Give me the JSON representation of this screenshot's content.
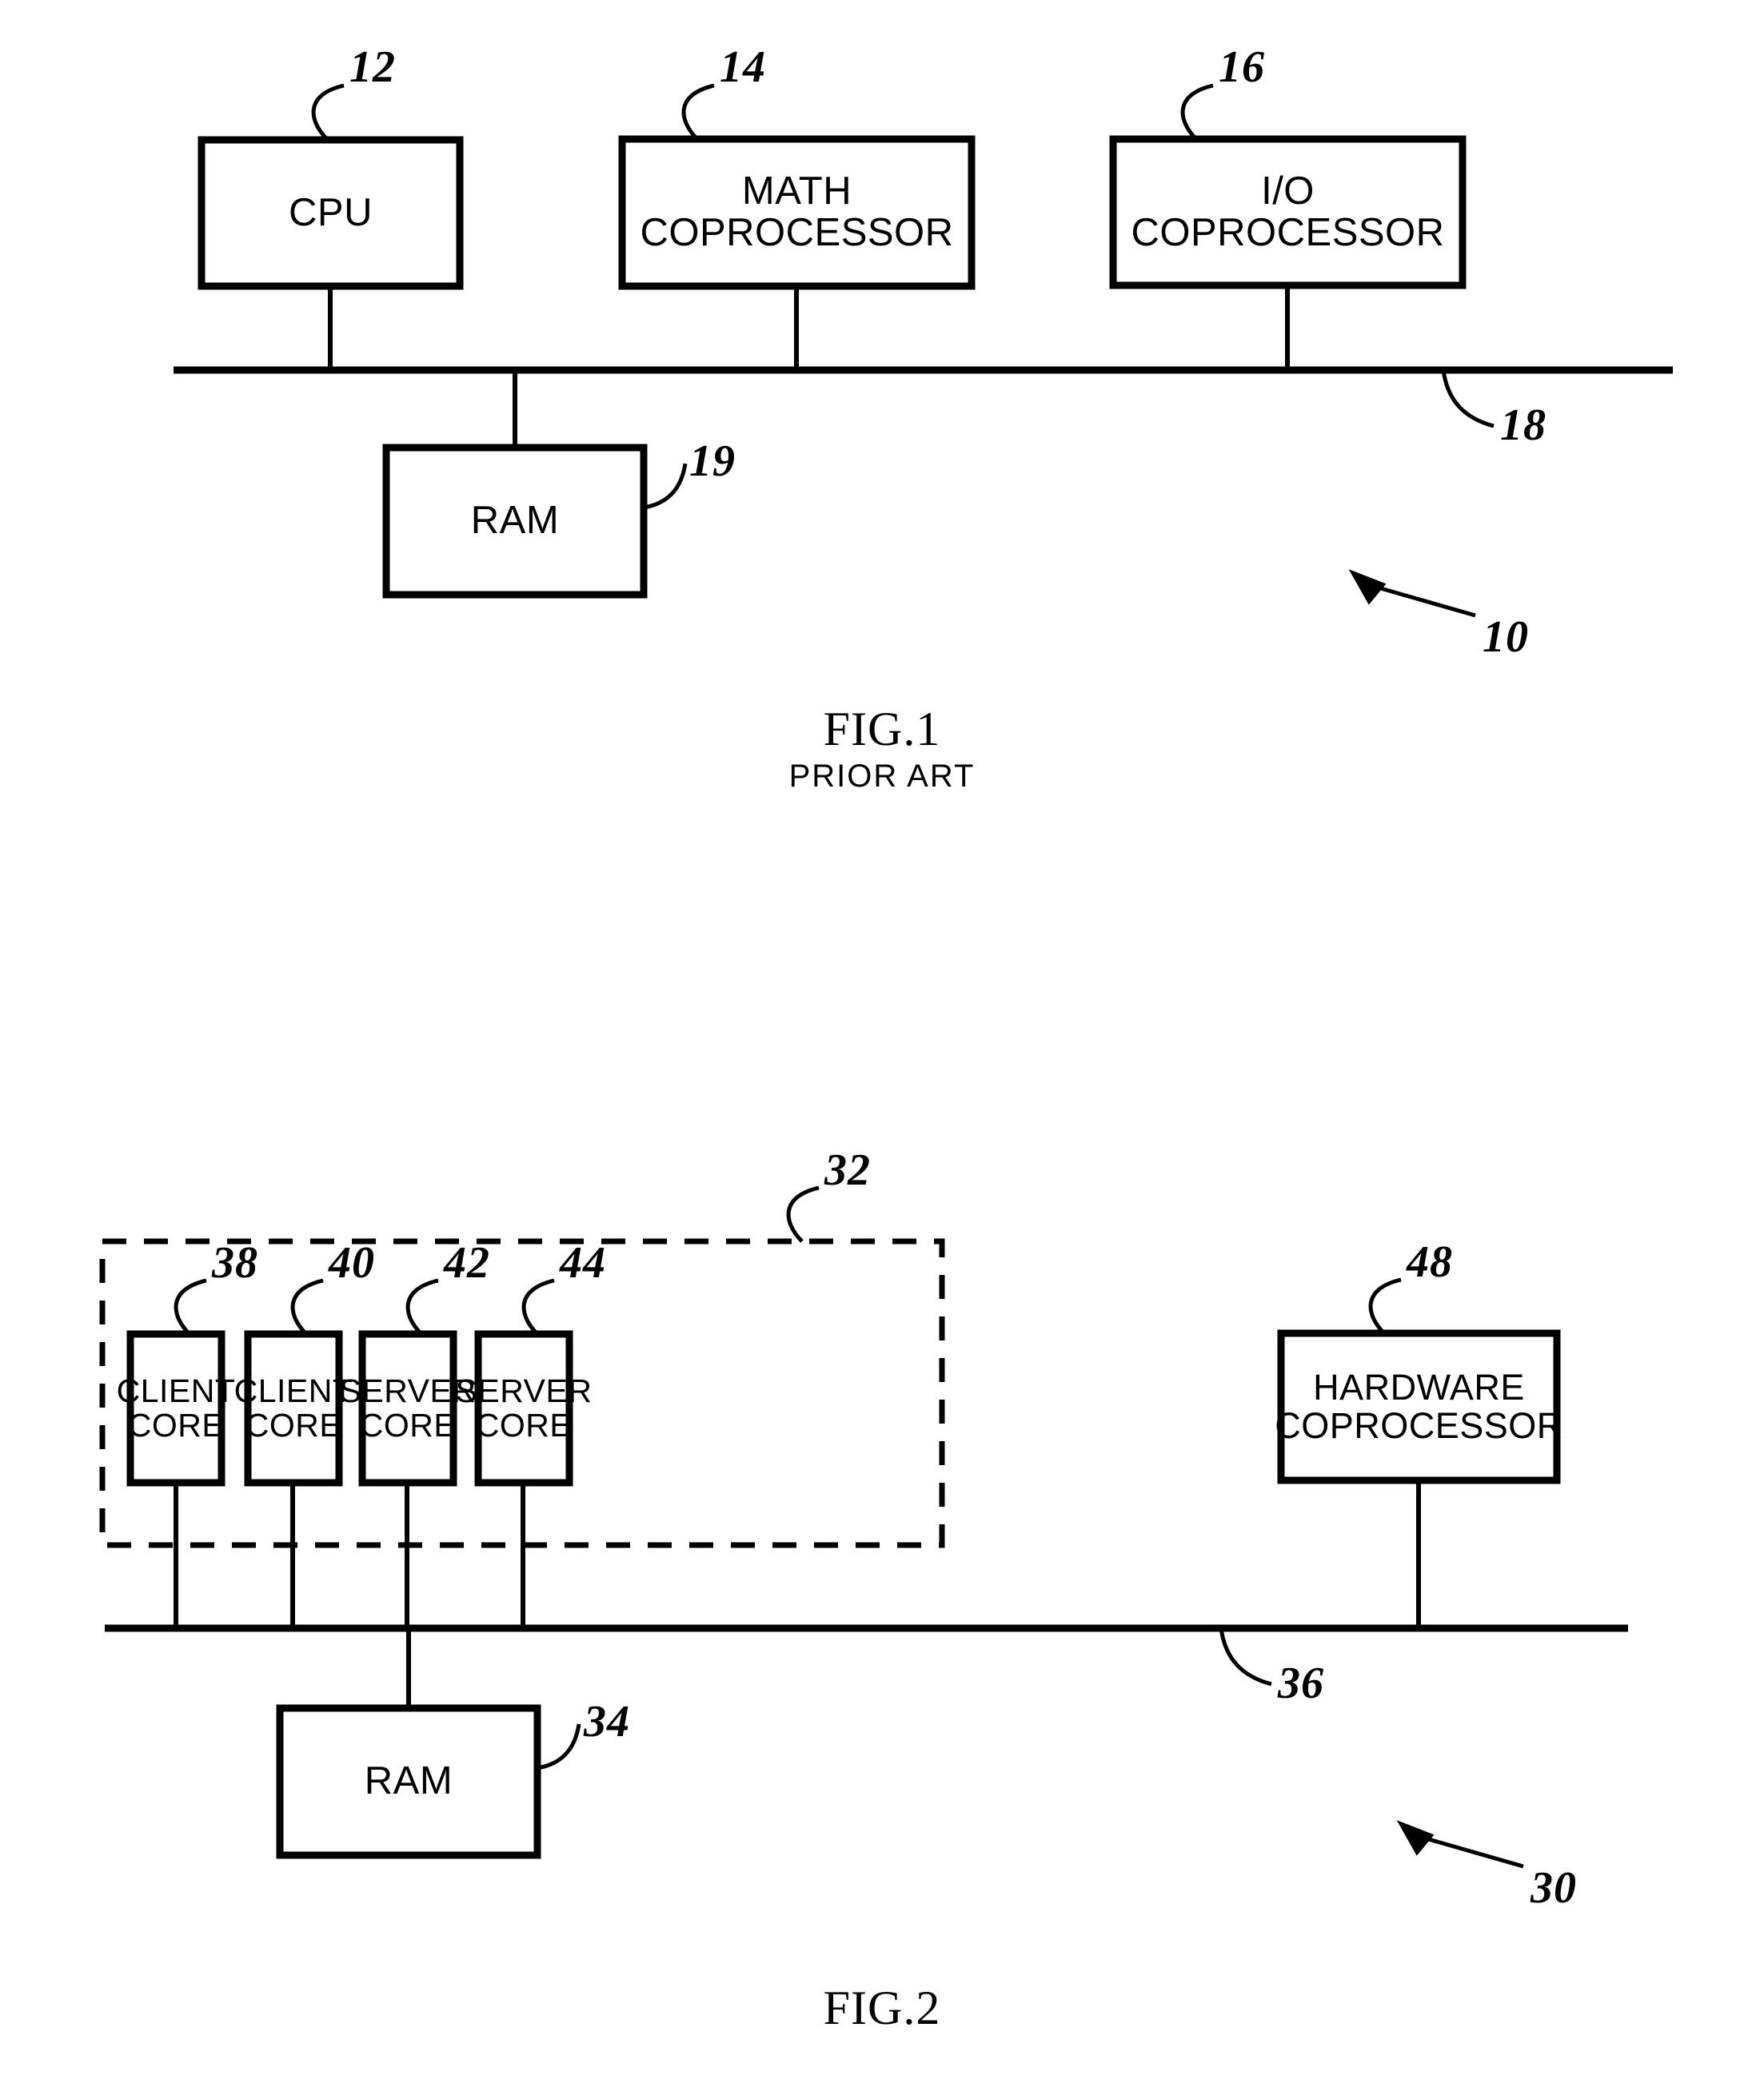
{
  "document": {
    "type": "patent-drawing-sheet",
    "background_color": "#ffffff",
    "ink_color": "#000000"
  },
  "figures": [
    {
      "id": "fig1",
      "caption_title": "FIG.1",
      "caption_subtitle": "PRIOR ART",
      "system_reference": "10",
      "bus_reference": "18",
      "blocks": [
        {
          "id": "cpu",
          "lines": [
            "CPU"
          ],
          "reference": "12"
        },
        {
          "id": "math-copro",
          "lines": [
            "MATH",
            "COPROCESSOR"
          ],
          "reference": "14"
        },
        {
          "id": "io-copro",
          "lines": [
            "I/O",
            "COPROCESSOR"
          ],
          "reference": "16"
        },
        {
          "id": "ram",
          "lines": [
            "RAM"
          ],
          "reference": "19"
        }
      ]
    },
    {
      "id": "fig2",
      "caption_title": "FIG.2",
      "caption_subtitle": "",
      "system_reference": "30",
      "bus_reference": "36",
      "group_reference": "32",
      "blocks": [
        {
          "id": "client-core-1",
          "lines": [
            "CLIENT",
            "CORE"
          ],
          "reference": "38"
        },
        {
          "id": "client-core-2",
          "lines": [
            "CLIENT",
            "CORE"
          ],
          "reference": "40"
        },
        {
          "id": "server-core-1",
          "lines": [
            "SERVER",
            "CORE"
          ],
          "reference": "42"
        },
        {
          "id": "server-core-2",
          "lines": [
            "SERVER",
            "CORE"
          ],
          "reference": "44"
        },
        {
          "id": "hardware-copro",
          "lines": [
            "HARDWARE",
            "COPROCESSOR"
          ],
          "reference": "48"
        },
        {
          "id": "ram",
          "lines": [
            "RAM"
          ],
          "reference": "34"
        }
      ]
    }
  ]
}
